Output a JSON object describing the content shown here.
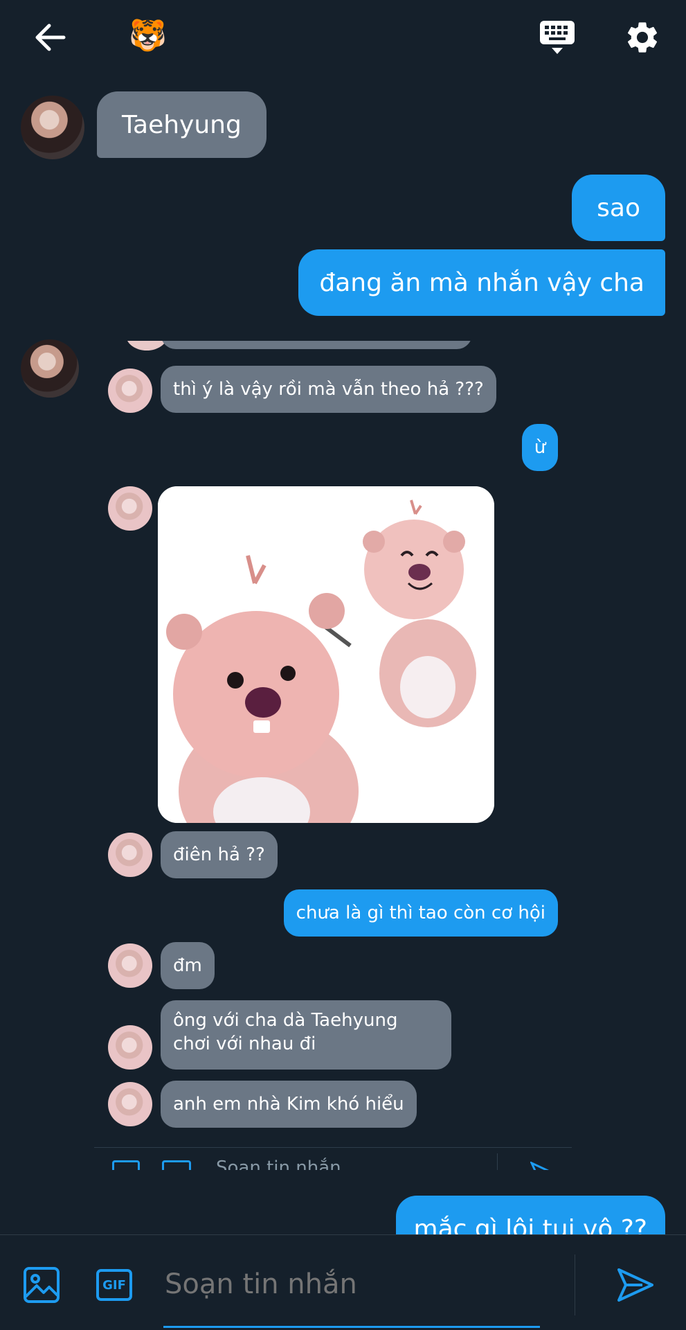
{
  "header": {
    "back_icon": "arrow-left-icon",
    "emoji": "🐯",
    "keyboard_icon": "keyboard-icon",
    "settings_icon": "gear-icon"
  },
  "messages": {
    "m1": "Taehyung",
    "m2": "sao",
    "m3": "đang ăn mà nhắn vậy cha",
    "embedded": {
      "e1": "thì ý là vậy rồi mà vẫn theo hả ???",
      "e2": "ừ",
      "e3": "điên hả ??",
      "e4": "chưa là gì thì tao còn cơ hội",
      "e5": "đm",
      "e6": "ông với cha dà Taehyung chơi với nhau đi",
      "e7": "anh em nhà Kim khó hiểu",
      "composer_placeholder_partial": "Soạn tin nhắn"
    },
    "m4_partial": "mắc gì lôi tui vô ??"
  },
  "composer": {
    "placeholder": "Soạn tin nhắn",
    "gif_label": "GIF",
    "image_icon": "image-icon",
    "send_icon": "send-icon"
  },
  "colors": {
    "background": "#15202b",
    "incoming": "#6b7785",
    "outgoing": "#1d9bf0"
  }
}
